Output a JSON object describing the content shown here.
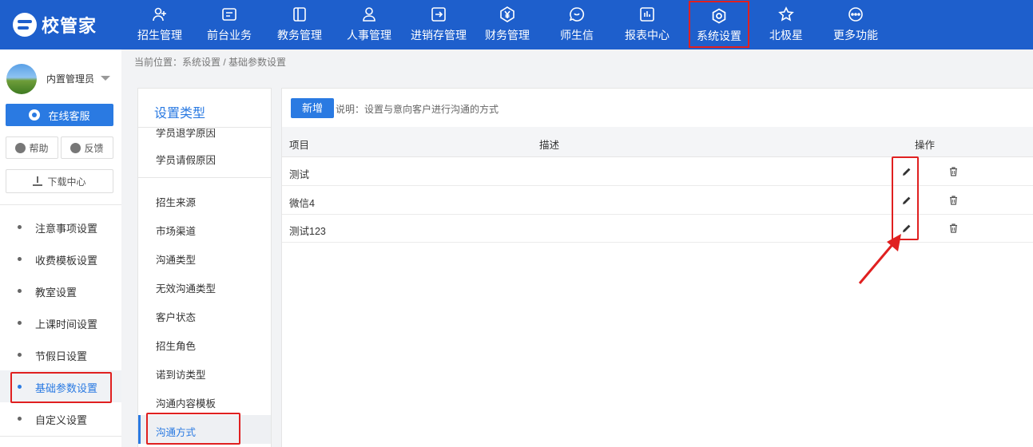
{
  "app": {
    "logo_text": "校管家"
  },
  "nav": {
    "items": [
      {
        "label": "招生管理",
        "icon": "user-add-icon"
      },
      {
        "label": "前台业务",
        "icon": "message-box-icon"
      },
      {
        "label": "教务管理",
        "icon": "book-icon"
      },
      {
        "label": "人事管理",
        "icon": "person-icon"
      },
      {
        "label": "进销存管理",
        "icon": "inventory-icon"
      },
      {
        "label": "财务管理",
        "icon": "yuan-icon"
      },
      {
        "label": "师生信",
        "icon": "chat-bubble-icon"
      },
      {
        "label": "报表中心",
        "icon": "report-chart-icon"
      },
      {
        "label": "系统设置",
        "icon": "gear-icon"
      },
      {
        "label": "北极星",
        "icon": "star-icon"
      },
      {
        "label": "更多功能",
        "icon": "more-icon"
      }
    ],
    "active_index": 8
  },
  "sidebar": {
    "user_name": "内置管理员",
    "service_label": "在线客服",
    "help_label": "帮助",
    "feedback_label": "反馈",
    "download_label": "下载中心",
    "items": [
      {
        "label": "注意事项设置"
      },
      {
        "label": "收费模板设置"
      },
      {
        "label": "教室设置"
      },
      {
        "label": "上课时间设置"
      },
      {
        "label": "节假日设置"
      },
      {
        "label": "基础参数设置"
      },
      {
        "label": "自定义设置"
      }
    ],
    "active_index": 5
  },
  "breadcrumb": {
    "text": "当前位置：系统设置 / 基础参数设置"
  },
  "categories": {
    "title": "设置类型",
    "partial_top": "学员退学原因",
    "group_a": [
      {
        "label": "学员请假原因"
      }
    ],
    "group_b": [
      {
        "label": "招生来源"
      },
      {
        "label": "市场渠道"
      },
      {
        "label": "沟通类型"
      },
      {
        "label": "无效沟通类型"
      },
      {
        "label": "客户状态"
      },
      {
        "label": "招生角色"
      },
      {
        "label": "诺到访类型"
      },
      {
        "label": "沟通内容模板"
      },
      {
        "label": "沟通方式"
      }
    ],
    "active_label": "沟通方式"
  },
  "main": {
    "add_label": "新增",
    "description": "说明：设置与意向客户进行沟通的方式",
    "columns": {
      "item": "项目",
      "desc": "描述",
      "ops": "操作"
    },
    "rows": [
      {
        "item": "测试",
        "desc": ""
      },
      {
        "item": "微信4",
        "desc": ""
      },
      {
        "item": "测试123",
        "desc": ""
      }
    ]
  },
  "colors": {
    "primary": "#1e5fcc",
    "accent": "#2a7ae2",
    "annotation": "#e02020"
  }
}
